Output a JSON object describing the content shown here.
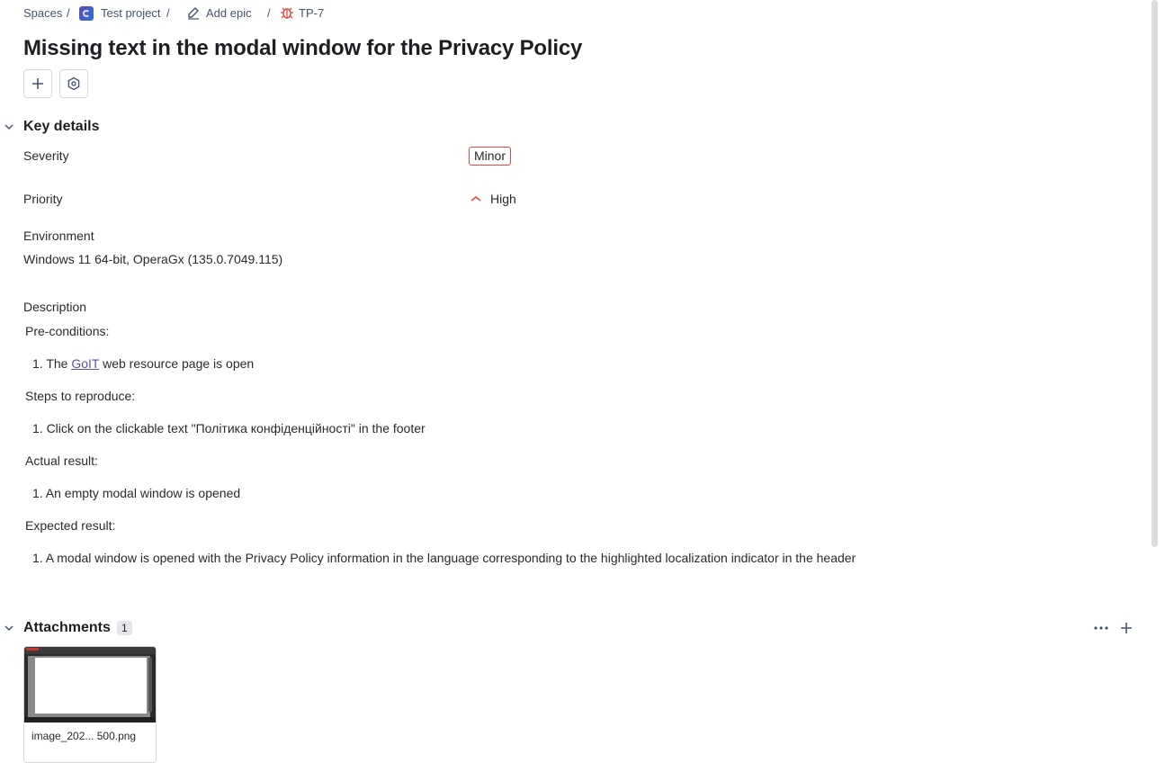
{
  "breadcrumbs": {
    "spaces": "Spaces",
    "project": "Test project",
    "add_epic": "Add epic",
    "issue_key": "TP-7",
    "separator": "/"
  },
  "issue": {
    "title": "Missing text in the modal window for the Privacy Policy"
  },
  "key_details": {
    "heading": "Key details",
    "severity_label": "Severity",
    "severity_value": "Minor",
    "priority_label": "Priority",
    "priority_value": "High",
    "environment_label": "Environment",
    "environment_value": "Windows 11 64-bit, OperaGx (135.0.7049.115)"
  },
  "description": {
    "label": "Description",
    "preconditions_heading": "Pre-conditions:",
    "precondition_1_prefix": "1. The ",
    "precondition_1_link": "GoIT",
    "precondition_1_suffix": " web resource page is open",
    "steps_heading": "Steps to reproduce:",
    "step_1": "1. Click on the clickable text \"Політика конфіденційності\" in the footer",
    "actual_heading": "Actual result:",
    "actual_1": "1. An empty modal window is opened",
    "expected_heading": "Expected result:",
    "expected_1": "1. A modal window is opened with the Privacy Policy information in the language corresponding to the highlighted localization indicator in the header"
  },
  "attachments": {
    "heading": "Attachments",
    "count": "1",
    "files": [
      {
        "name": "image_202... 500.png"
      }
    ]
  },
  "colors": {
    "bug_icon": "#e2483d",
    "priority_high": "#e2483d",
    "severity_border": "#e2483d",
    "link": "#5e4db2"
  }
}
